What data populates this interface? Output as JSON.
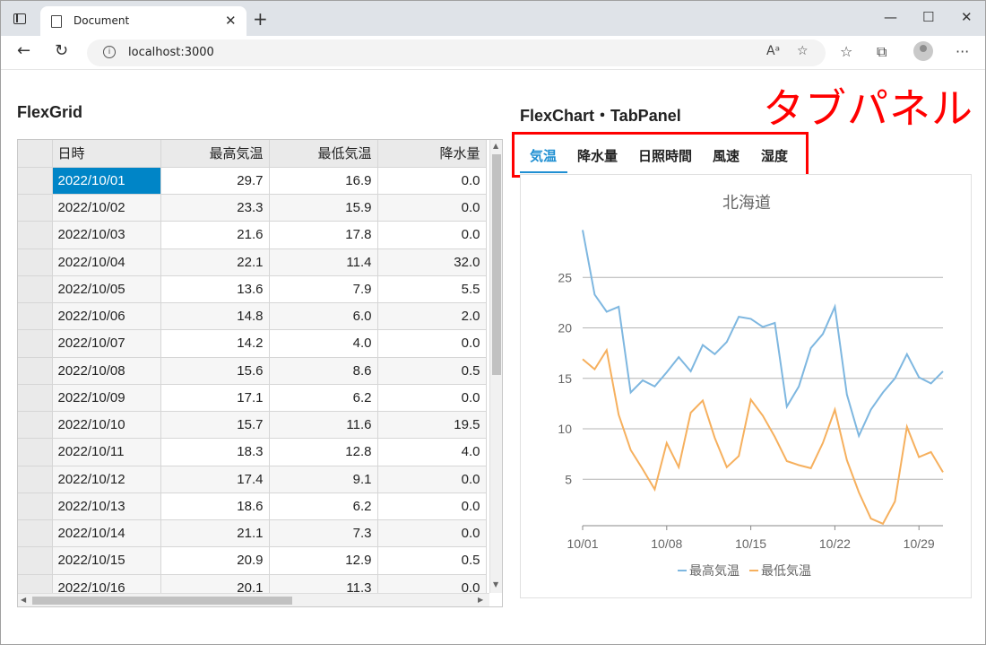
{
  "browser": {
    "tab_title": "Document",
    "url": "localhost:3000"
  },
  "grid": {
    "heading": "FlexGrid",
    "columns": [
      "日時",
      "最高気温",
      "最低気温",
      "降水量"
    ],
    "rows": [
      [
        "2022/10/01",
        "29.7",
        "16.9",
        "0.0"
      ],
      [
        "2022/10/02",
        "23.3",
        "15.9",
        "0.0"
      ],
      [
        "2022/10/03",
        "21.6",
        "17.8",
        "0.0"
      ],
      [
        "2022/10/04",
        "22.1",
        "11.4",
        "32.0"
      ],
      [
        "2022/10/05",
        "13.6",
        "7.9",
        "5.5"
      ],
      [
        "2022/10/06",
        "14.8",
        "6.0",
        "2.0"
      ],
      [
        "2022/10/07",
        "14.2",
        "4.0",
        "0.0"
      ],
      [
        "2022/10/08",
        "15.6",
        "8.6",
        "0.5"
      ],
      [
        "2022/10/09",
        "17.1",
        "6.2",
        "0.0"
      ],
      [
        "2022/10/10",
        "15.7",
        "11.6",
        "19.5"
      ],
      [
        "2022/10/11",
        "18.3",
        "12.8",
        "4.0"
      ],
      [
        "2022/10/12",
        "17.4",
        "9.1",
        "0.0"
      ],
      [
        "2022/10/13",
        "18.6",
        "6.2",
        "0.0"
      ],
      [
        "2022/10/14",
        "21.1",
        "7.3",
        "0.0"
      ],
      [
        "2022/10/15",
        "20.9",
        "12.9",
        "0.5"
      ],
      [
        "2022/10/16",
        "20.1",
        "11.3",
        "0.0"
      ]
    ]
  },
  "panel": {
    "heading": "FlexChart・TabPanel",
    "annotation": "タブパネル",
    "tabs": [
      "気温",
      "降水量",
      "日照時間",
      "風速",
      "湿度"
    ],
    "active_tab": "気温"
  },
  "chart_data": {
    "type": "line",
    "title": "北海道",
    "xlabel": "",
    "ylabel": "",
    "x_tick_labels": [
      "10/01",
      "10/08",
      "10/15",
      "10/22",
      "10/29"
    ],
    "y_ticks": [
      5,
      10,
      15,
      20,
      25
    ],
    "grid": true,
    "legend_position": "bottom",
    "x": [
      "10/01",
      "10/02",
      "10/03",
      "10/04",
      "10/05",
      "10/06",
      "10/07",
      "10/08",
      "10/09",
      "10/10",
      "10/11",
      "10/12",
      "10/13",
      "10/14",
      "10/15",
      "10/16",
      "10/17",
      "10/18",
      "10/19",
      "10/20",
      "10/21",
      "10/22",
      "10/23",
      "10/24",
      "10/25",
      "10/26",
      "10/27",
      "10/28",
      "10/29",
      "10/30",
      "10/31"
    ],
    "series": [
      {
        "name": "最高気温",
        "color": "#7eb7e0",
        "values": [
          29.7,
          23.3,
          21.6,
          22.1,
          13.6,
          14.8,
          14.2,
          15.6,
          17.1,
          15.7,
          18.3,
          17.4,
          18.6,
          21.1,
          20.9,
          20.1,
          20.5,
          12.2,
          14.2,
          18.0,
          19.4,
          22.1,
          13.4,
          9.3,
          11.9,
          13.6,
          15.0,
          17.4,
          15.1,
          14.5,
          15.7
        ]
      },
      {
        "name": "最低気温",
        "color": "#f6b05e",
        "values": [
          16.9,
          15.9,
          17.8,
          11.4,
          7.9,
          6.0,
          4.0,
          8.6,
          6.2,
          11.6,
          12.8,
          9.1,
          6.2,
          7.3,
          12.9,
          11.3,
          9.2,
          6.8,
          6.4,
          6.1,
          8.6,
          11.9,
          6.9,
          3.7,
          1.1,
          0.6,
          2.8,
          10.2,
          7.2,
          7.7,
          5.7
        ]
      }
    ]
  },
  "colors": {
    "accent": "#1f8fd2",
    "selected_cell": "#0085c7",
    "annotation": "#ff0000"
  }
}
